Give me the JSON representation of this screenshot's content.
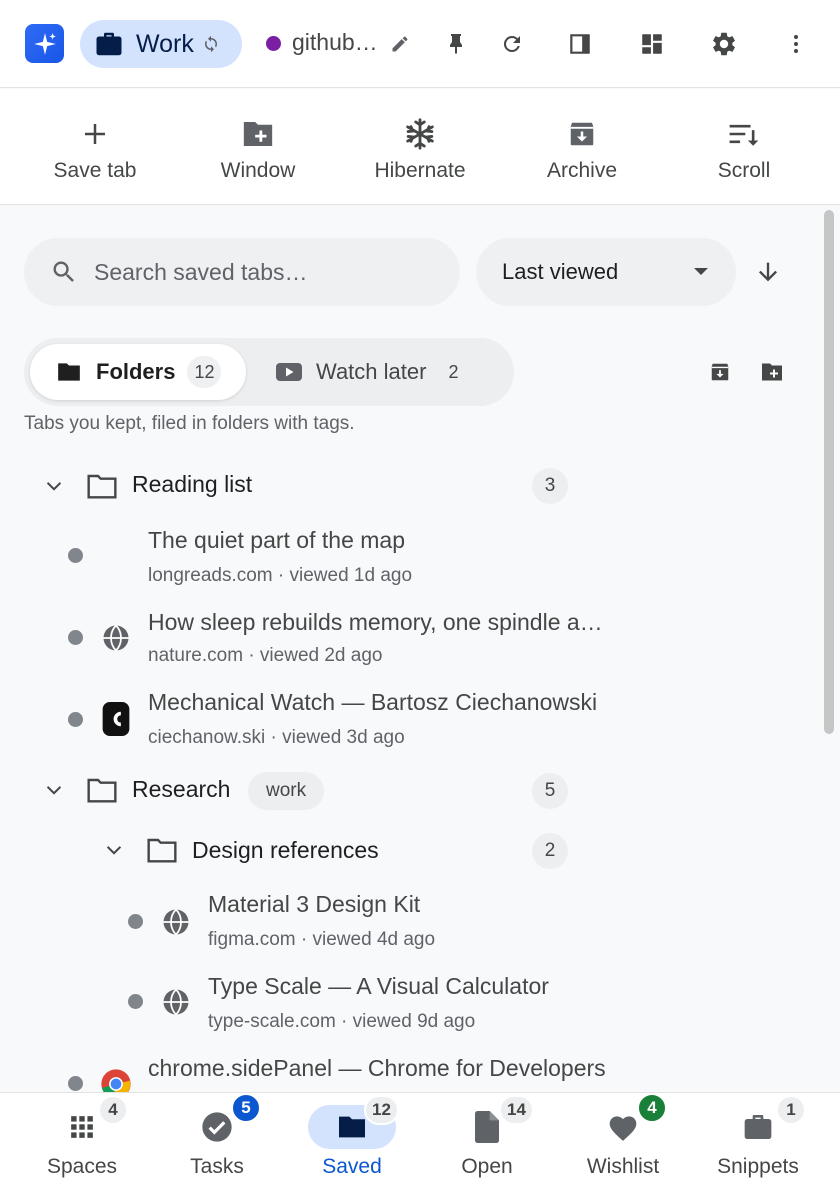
{
  "header": {
    "space_name": "Work",
    "url_text": "github…",
    "url_dot_color": "#7b1fa2"
  },
  "actions": [
    {
      "label": "Save tab",
      "icon": "plus-icon"
    },
    {
      "label": "Window",
      "icon": "folder-plus-icon"
    },
    {
      "label": "Hibernate",
      "icon": "snowflake-icon"
    },
    {
      "label": "Archive",
      "icon": "archive-icon"
    },
    {
      "label": "Scroll",
      "icon": "sort-icon"
    }
  ],
  "search": {
    "placeholder": "Search saved tabs…"
  },
  "sort": {
    "value": "Last viewed"
  },
  "tabs": {
    "folders_label": "Folders",
    "folders_count": "12",
    "watch_label": "Watch later",
    "watch_count": "2",
    "description": "Tabs you kept, filed in folders with tags."
  },
  "tree": {
    "reading": {
      "name": "Reading list",
      "count": "3",
      "items": [
        {
          "title": "The quiet part of the map",
          "meta": "longreads.com · viewed 1d ago"
        },
        {
          "title": "How sleep rebuilds memory, one spindle a…",
          "meta": "nature.com · viewed 2d ago"
        },
        {
          "title": "Mechanical Watch — Bartosz Ciechanowski",
          "meta": "ciechanow.ski · viewed 3d ago"
        }
      ]
    },
    "research": {
      "name": "Research",
      "tag": "work",
      "count": "5",
      "sub": {
        "name": "Design references",
        "count": "2",
        "items": [
          {
            "title": "Material 3 Design Kit",
            "meta": "figma.com · viewed 4d ago"
          },
          {
            "title": "Type Scale — A Visual Calculator",
            "meta": "type-scale.com · viewed 9d ago"
          }
        ]
      },
      "items": [
        {
          "title": "chrome.sidePanel — Chrome for Developers",
          "meta": ""
        }
      ]
    }
  },
  "nav": [
    {
      "label": "Spaces",
      "badge": "4"
    },
    {
      "label": "Tasks",
      "badge": "5"
    },
    {
      "label": "Saved",
      "badge": "12"
    },
    {
      "label": "Open",
      "badge": "14"
    },
    {
      "label": "Wishlist",
      "badge": "4"
    },
    {
      "label": "Snippets",
      "badge": "1"
    }
  ],
  "colors": {
    "accent": "#0b57d0",
    "accent_container": "#d3e3fd",
    "success": "#188038"
  }
}
